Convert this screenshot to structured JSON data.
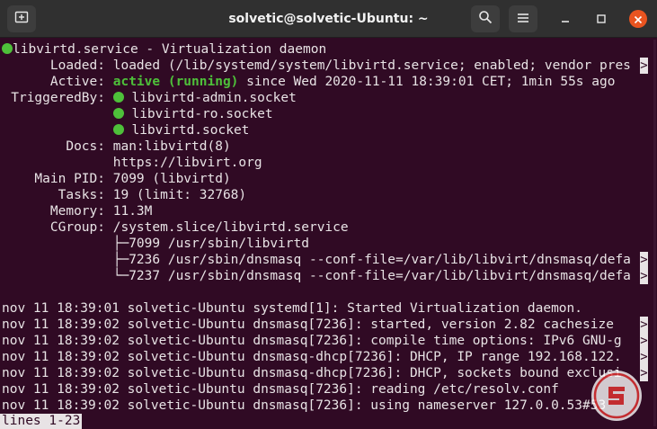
{
  "window": {
    "title": "solvetic@solvetic-Ubuntu: ~",
    "icons": {
      "new_tab": "new-tab-icon",
      "search": "search-icon",
      "menu": "hamburger-menu-icon",
      "minimize": "minimize-icon",
      "maximize": "maximize-icon",
      "close": "close-icon"
    }
  },
  "terminal": {
    "colors": {
      "background": "#300a24",
      "text": "#e8e3e5",
      "active": "#4ec03a",
      "close_button": "#e95420"
    },
    "status": {
      "unit": "libvirtd.service - Virtualization daemon",
      "loaded_label": "Loaded:",
      "loaded_value": "loaded (/lib/systemd/system/libvirtd.service; enabled; vendor pres",
      "active_label": "Active:",
      "active_state": "active (running)",
      "active_rest": " since Wed 2020-11-11 18:39:01 CET; 1min 55s ago",
      "triggered_label": "TriggeredBy:",
      "triggered": [
        "libvirtd-admin.socket",
        "libvirtd-ro.socket",
        "libvirtd.socket"
      ],
      "docs_label": "Docs:",
      "docs": [
        "man:libvirtd(8)",
        "https://libvirt.org"
      ],
      "pid_label": "Main PID:",
      "pid_value": "7099 (libvirtd)",
      "tasks_label": "Tasks:",
      "tasks_value": "19 (limit: 32768)",
      "memory_label": "Memory:",
      "memory_value": "11.3M",
      "cgroup_label": "CGroup:",
      "cgroup_value": "/system.slice/libvirtd.service",
      "cgroup_tree": [
        "├─7099 /usr/sbin/libvirtd",
        "├─7236 /usr/sbin/dnsmasq --conf-file=/var/lib/libvirt/dnsmasq/defa",
        "└─7237 /usr/sbin/dnsmasq --conf-file=/var/lib/libvirt/dnsmasq/defa"
      ]
    },
    "logs": [
      "nov 11 18:39:01 solvetic-Ubuntu systemd[1]: Started Virtualization daemon.",
      "nov 11 18:39:02 solvetic-Ubuntu dnsmasq[7236]: started, version 2.82 cachesize",
      "nov 11 18:39:02 solvetic-Ubuntu dnsmasq[7236]: compile time options: IPv6 GNU-g",
      "nov 11 18:39:02 solvetic-Ubuntu dnsmasq-dhcp[7236]: DHCP, IP range 192.168.122.",
      "nov 11 18:39:02 solvetic-Ubuntu dnsmasq-dhcp[7236]: DHCP, sockets bound exclusi",
      "nov 11 18:39:02 solvetic-Ubuntu dnsmasq[7236]: reading /etc/resolv.conf",
      "nov 11 18:39:02 solvetic-Ubuntu dnsmasq[7236]: using nameserver 127.0.0.53#53"
    ],
    "truncation_marker": ">",
    "pager_status": "lines 1-23"
  }
}
